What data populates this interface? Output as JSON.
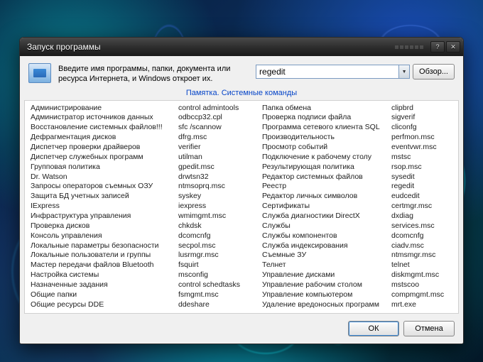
{
  "window": {
    "title": "Запуск программы",
    "instruction": "Введите имя программы, папки, документа или ресурса Интернета, и Windows откроет их.",
    "input_value": "regedit",
    "browse_label": "Обзор...",
    "hint_label": "Памятка. Системные команды",
    "ok_label": "ОК",
    "cancel_label": "Отмена"
  },
  "commands": {
    "col1_names": [
      "Администрирование",
      "Администратор источников данных",
      "Восстановление системных файлов!!!",
      "Дефрагментация дисков",
      "Диспетчер проверки драйверов",
      "Диспетчер служебных программ",
      "Групповая политика",
      "Dr. Watson",
      "Запросы операторов съемных ОЗУ",
      "Защита БД учетных записей",
      "IExpress",
      "Инфраструктура управления",
      "Проверка дисков",
      "Консоль управления",
      "Локальные параметры безопасности",
      "Локальные пользователи и группы",
      "Мастер передачи файлов Bluetooth",
      "Настройка системы",
      "Назначенные задания",
      "Общие папки",
      "Общие ресурсы DDE"
    ],
    "col2_cmds": [
      "control admintools",
      "odbccp32.cpl",
      "sfc /scannow",
      "dfrg.msc",
      "verifier",
      "utilman",
      "gpedit.msc",
      "drwtsn32",
      "ntmsoprq.msc",
      "syskey",
      "iexpress",
      "wmimgmt.msc",
      "chkdsk",
      "dcomcnfg",
      "secpol.msc",
      "lusrmgr.msc",
      "fsquirt",
      "msconfig",
      "control schedtasks",
      "fsmgmt.msc",
      "ddeshare"
    ],
    "col3_names": [
      "Папка обмена",
      "Проверка подписи файла",
      "Программа сетевого клиента SQL",
      "Производительность",
      "Просмотр событий",
      "Подключение к рабочему столу",
      "Результирующая политика",
      "Редактор системных файлов",
      "Реестр",
      "Редактор личных символов",
      "Сертификаты",
      "Служба диагностики DirectX",
      "Службы",
      "Службы компонентов",
      "Служба индексирования",
      "Съемные ЗУ",
      "Телнет",
      "Управление дисками",
      "Управление рабочим столом",
      "Управление компьютером",
      "Удаление вредоносных программ"
    ],
    "col4_cmds": [
      "clipbrd",
      "sigverif",
      "cliconfg",
      "perfmon.msc",
      "eventvwr.msc",
      "mstsc",
      "rsop.msc",
      "sysedit",
      "regedit",
      "eudcedit",
      "certmgr.msc",
      "dxdiag",
      "services.msc",
      "dcomcnfg",
      "ciadv.msc",
      "ntmsmgr.msc",
      "telnet",
      "diskmgmt.msc",
      "mstscoo",
      "compmgmt.msc",
      "mrt.exe"
    ]
  }
}
